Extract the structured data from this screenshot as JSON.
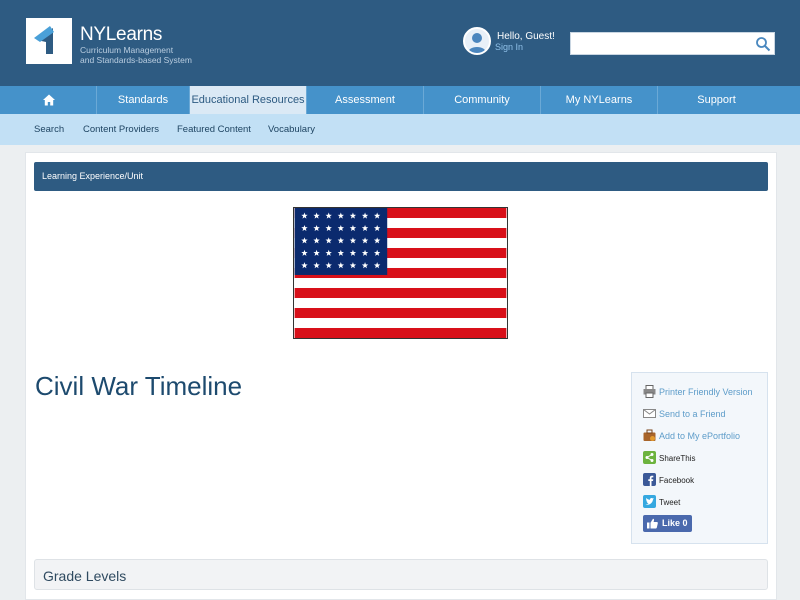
{
  "brand": {
    "title": "NYLearns",
    "subtitle_line1": "Curriculum Management",
    "subtitle_line2": "and Standards-based System"
  },
  "user": {
    "greeting": "Hello, Guest!",
    "signin": "Sign In"
  },
  "search": {
    "value": "",
    "placeholder": ""
  },
  "main_nav": [
    {
      "label": "Standards"
    },
    {
      "label": "Educational Resources"
    },
    {
      "label": "Assessment"
    },
    {
      "label": "Community"
    },
    {
      "label": "My NYLearns"
    },
    {
      "label": "Support"
    }
  ],
  "sub_nav": [
    {
      "label": "Search"
    },
    {
      "label": "Content Providers"
    },
    {
      "label": "Featured Content"
    },
    {
      "label": "Vocabulary"
    }
  ],
  "content": {
    "type_label": "Learning Experience/Unit",
    "title": "Civil War Timeline",
    "section_grade": "Grade Levels"
  },
  "share": {
    "printer": "Printer Friendly Version",
    "send": "Send to a Friend",
    "portfolio": "Add to My ePortfolio",
    "sharethis": "ShareThis",
    "facebook": "Facebook",
    "tweet": "Tweet",
    "like": "Like 0"
  },
  "colors": {
    "header": "#2e5b82",
    "nav": "#4592ca",
    "subnav": "#c2e0f5",
    "flag_red": "#d8101a",
    "flag_blue": "#0b2a6e"
  }
}
